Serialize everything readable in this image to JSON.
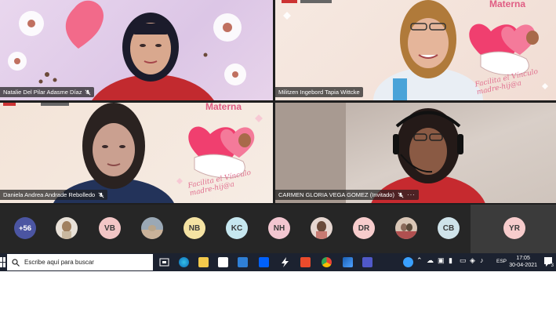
{
  "tiles": [
    {
      "name": "Natalie Del Pilar Adasme Díaz"
    },
    {
      "name": "Militzen Ingebord Tapia Wittcke"
    },
    {
      "name": "Daniela Andrea Andrade Rebolledo"
    },
    {
      "name": "CARMEN GLORIA VEGA GOMEZ (Invitado)",
      "more": "···"
    }
  ],
  "slide": {
    "brand": "Materna",
    "tagline_1": "Facilita el Vínculo",
    "tagline_2": "madre-hij@a"
  },
  "participants": {
    "overflow_count": "+56",
    "avatars": [
      {
        "initials": "",
        "kind": "photo",
        "color": "#a08060"
      },
      {
        "initials": "VB",
        "kind": "initials",
        "color": "#f2c6c6"
      },
      {
        "initials": "",
        "kind": "photo",
        "color": "#b9a58a"
      },
      {
        "initials": "NB",
        "kind": "initials",
        "color": "#f5e3a3"
      },
      {
        "initials": "KC",
        "kind": "initials",
        "color": "#c6e7ef"
      },
      {
        "initials": "NH",
        "kind": "initials",
        "color": "#f2c6d0"
      },
      {
        "initials": "",
        "kind": "photo",
        "color": "#c77a72"
      },
      {
        "initials": "DR",
        "kind": "initials",
        "color": "#f7cccc"
      },
      {
        "initials": "",
        "kind": "photo",
        "color": "#8a6a5a"
      },
      {
        "initials": "CB",
        "kind": "initials",
        "color": "#cfe3ea"
      },
      {
        "initials": "YR",
        "kind": "initials",
        "color": "#f7cccc"
      }
    ]
  },
  "taskbar": {
    "search_placeholder": "Escribe aquí para buscar",
    "language": "ESP",
    "time": "17:05",
    "date": "30-04-2021",
    "notification_count": "3"
  },
  "colors": {
    "teams_purple": "#4b55a2",
    "brand_pink": "#e05d83",
    "taskbar_bg": "#1c2230"
  }
}
